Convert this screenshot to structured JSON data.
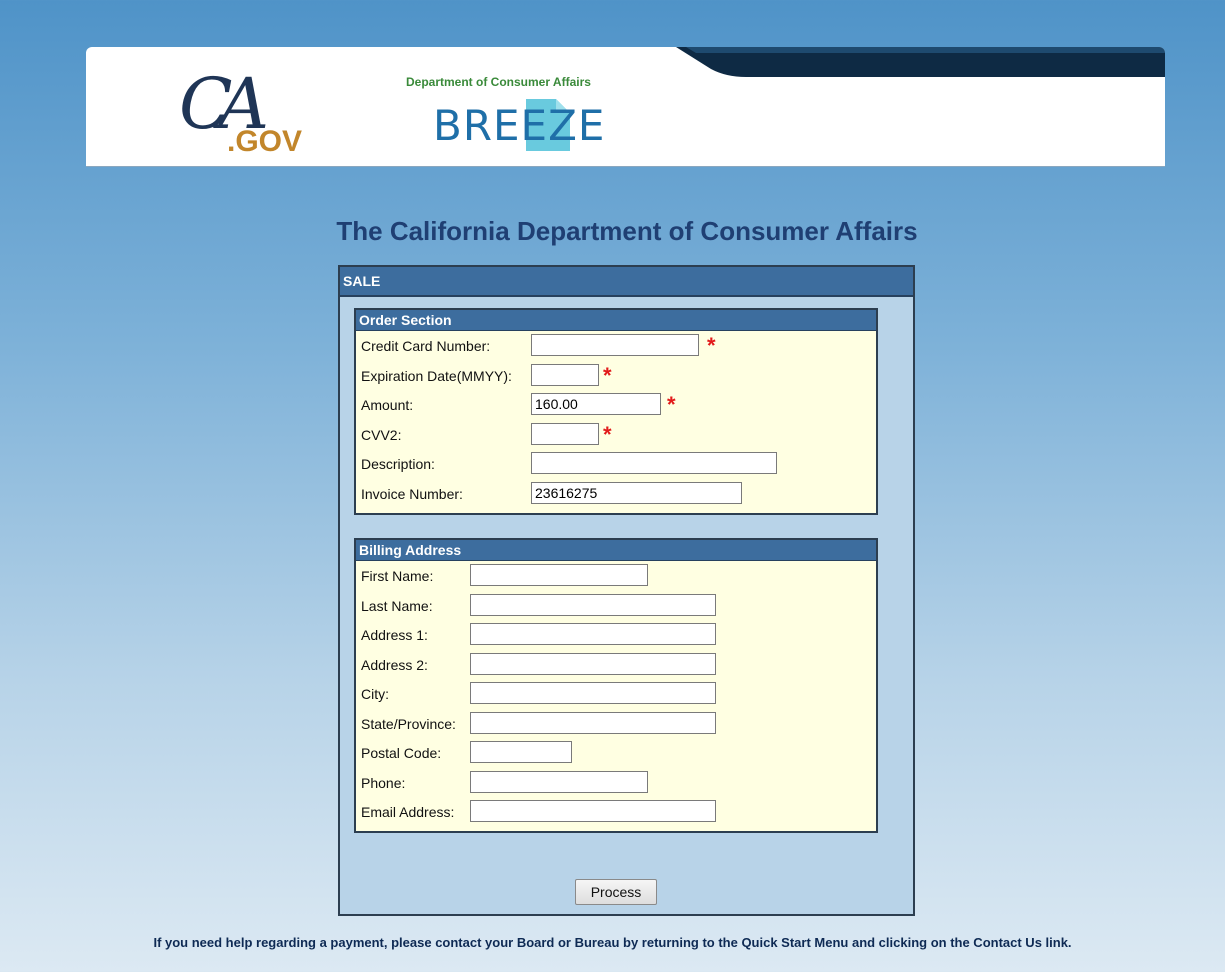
{
  "header": {
    "ca_logo_ca": "CA",
    "ca_logo_gov": ".GOV",
    "dept_name": "Department of Consumer Affairs",
    "breeze_logo": "BREEZE",
    "accent_dark": "#0e2a44"
  },
  "page": {
    "title": "The California Department of Consumer Affairs"
  },
  "sale": {
    "title": "SALE",
    "order_section": {
      "title": "Order Section",
      "fields": [
        {
          "label": "Credit Card Number:",
          "value": "",
          "required": true
        },
        {
          "label": "Expiration Date(MMYY):",
          "value": "",
          "required": true
        },
        {
          "label": "Amount:",
          "value": "160.00",
          "required": true
        },
        {
          "label": "CVV2:",
          "value": "",
          "required": true
        },
        {
          "label": "Description:",
          "value": "",
          "required": false
        },
        {
          "label": "Invoice Number:",
          "value": "23616275",
          "required": false
        }
      ],
      "required_mark": "*"
    },
    "billing_section": {
      "title": "Billing Address",
      "fields": [
        {
          "label": "First Name:",
          "value": ""
        },
        {
          "label": "Last Name:",
          "value": ""
        },
        {
          "label": "Address 1:",
          "value": ""
        },
        {
          "label": "Address 2:",
          "value": ""
        },
        {
          "label": "City:",
          "value": ""
        },
        {
          "label": "State/Province:",
          "value": ""
        },
        {
          "label": "Postal Code:",
          "value": ""
        },
        {
          "label": "Phone:",
          "value": ""
        },
        {
          "label": "Email Address:",
          "value": ""
        }
      ]
    },
    "process_label": "Process"
  },
  "footer": {
    "help_text": "If you need help regarding a payment, please contact your Board or Bureau by returning to the Quick Start Menu and clicking on the Contact Us link."
  }
}
